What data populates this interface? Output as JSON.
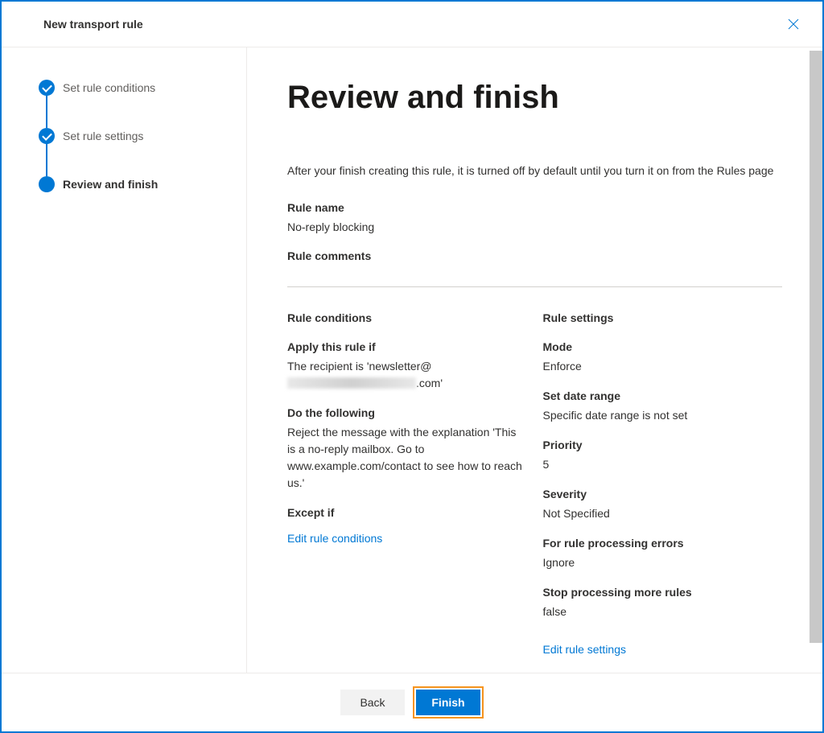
{
  "header": {
    "title": "New transport rule"
  },
  "steps": [
    {
      "label": "Set rule conditions",
      "completed": true
    },
    {
      "label": "Set rule settings",
      "completed": true
    },
    {
      "label": "Review and finish",
      "current": true
    }
  ],
  "main": {
    "title": "Review and finish",
    "intro": "After your finish creating this rule, it is turned off by default until you turn it on from the Rules page",
    "rule_name_label": "Rule name",
    "rule_name_value": "No-reply blocking",
    "rule_comments_label": "Rule comments",
    "conditions": {
      "heading": "Rule conditions",
      "apply_label": "Apply this rule if",
      "apply_value_prefix": "The recipient is 'newsletter@",
      "apply_value_suffix": ".com'",
      "do_label": "Do the following",
      "do_value": "Reject the message with the explanation 'This  is a no-reply mailbox. Go to www.example.com/contact to see how to reach us.'",
      "except_label": "Except if",
      "edit_link": "Edit rule conditions"
    },
    "settings": {
      "heading": "Rule settings",
      "mode_label": "Mode",
      "mode_value": "Enforce",
      "date_label": "Set date range",
      "date_value": "Specific date range is not set",
      "priority_label": "Priority",
      "priority_value": "5",
      "severity_label": "Severity",
      "severity_value": "Not Specified",
      "errors_label": "For rule processing errors",
      "errors_value": "Ignore",
      "stop_label": "Stop processing more rules",
      "stop_value": "false",
      "edit_link": "Edit rule settings"
    }
  },
  "footer": {
    "back": "Back",
    "finish": "Finish"
  }
}
